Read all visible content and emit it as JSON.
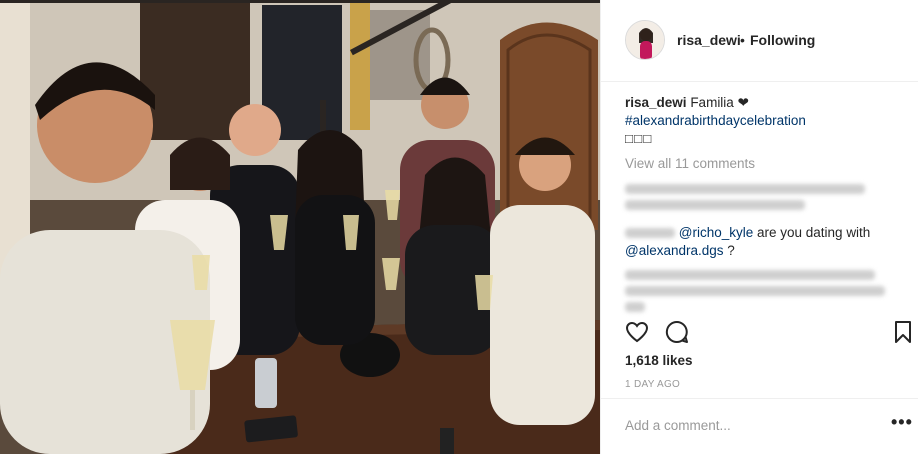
{
  "post": {
    "image_alt": "Group of friends raising champagne glasses around a table",
    "username": "risa_dewi",
    "separator": "•",
    "follow_status": "Following",
    "caption": {
      "username": "risa_dewi",
      "text": "Familia ❤",
      "hashtag": "#alexandrabirthdaycelebration",
      "extra": "□□□"
    },
    "view_all_comments": "View all 11 comments",
    "visible_comment": {
      "mention1": "@richo_kyle",
      "text": " are you dating with",
      "mention2": "@alexandra.dgs",
      "suffix": " ?"
    },
    "likes": "1,618 likes",
    "timestamp": "1 DAY AGO",
    "add_comment_placeholder": "Add a comment...",
    "more_options": "•••"
  },
  "colors": {
    "link": "#003569",
    "muted": "#999999",
    "text": "#262626",
    "border": "#efefef"
  },
  "icons": [
    "heart-icon",
    "comment-icon",
    "bookmark-icon",
    "more-options-icon"
  ]
}
